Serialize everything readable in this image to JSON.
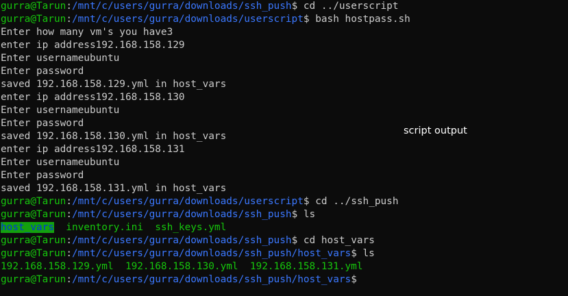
{
  "prompt_user": "gurra@Tarun",
  "annotation": "script output",
  "lines": [
    {
      "type": "prompt",
      "path": "/mnt/c/users/gurra/downloads/ssh_push",
      "cmd": "cd ../userscript"
    },
    {
      "type": "prompt",
      "path": "/mnt/c/users/gurra/downloads/userscript",
      "cmd": "bash hostpass.sh"
    },
    {
      "type": "text",
      "text": "Enter how many vm's you have3"
    },
    {
      "type": "text",
      "text": "enter ip address192.168.158.129"
    },
    {
      "type": "text",
      "text": "Enter usernameubuntu"
    },
    {
      "type": "text",
      "text": "Enter password"
    },
    {
      "type": "text",
      "text": "saved 192.168.158.129.yml in host_vars"
    },
    {
      "type": "text",
      "text": "enter ip address192.168.158.130"
    },
    {
      "type": "text",
      "text": "Enter usernameubuntu"
    },
    {
      "type": "text",
      "text": "Enter password"
    },
    {
      "type": "text",
      "text": "saved 192.168.158.130.yml in host_vars"
    },
    {
      "type": "text",
      "text": "enter ip address192.168.158.131"
    },
    {
      "type": "text",
      "text": "Enter usernameubuntu"
    },
    {
      "type": "text",
      "text": "Enter password"
    },
    {
      "type": "text",
      "text": "saved 192.168.158.131.yml in host_vars"
    },
    {
      "type": "prompt",
      "path": "/mnt/c/users/gurra/downloads/userscript",
      "cmd": "cd ../ssh_push"
    },
    {
      "type": "prompt",
      "path": "/mnt/c/users/gurra/downloads/ssh_push",
      "cmd": "ls"
    },
    {
      "type": "ls",
      "dir": "host_vars",
      "files": "  inventory.ini  ssh_keys.yml"
    },
    {
      "type": "prompt",
      "path": "/mnt/c/users/gurra/downloads/ssh_push",
      "cmd": "cd host_vars"
    },
    {
      "type": "prompt",
      "path": "/mnt/c/users/gurra/downloads/ssh_push/host_vars",
      "cmd": "ls"
    },
    {
      "type": "files",
      "text": "192.168.158.129.yml  192.168.158.130.yml  192.168.158.131.yml"
    },
    {
      "type": "prompt",
      "path": "/mnt/c/users/gurra/downloads/ssh_push/host_vars",
      "cmd": ""
    }
  ]
}
